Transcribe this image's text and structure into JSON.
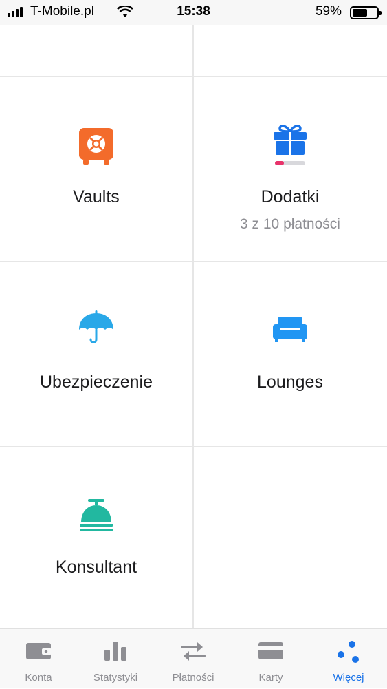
{
  "status_bar": {
    "carrier": "T-Mobile.pl",
    "time": "15:38",
    "battery": "59%"
  },
  "tiles": {
    "vaults": {
      "label": "Vaults",
      "icon": "safe-icon",
      "color": "#f36b2b"
    },
    "dodatki": {
      "label": "Dodatki",
      "sub": "3 z 10 płatności",
      "icon": "gift-icon",
      "color": "#1a73e8",
      "progress": 0.3
    },
    "ubezpieczenie": {
      "label": "Ubezpieczenie",
      "icon": "umbrella-icon",
      "color": "#29a8e8"
    },
    "lounges": {
      "label": "Lounges",
      "icon": "sofa-icon",
      "color": "#2196f3"
    },
    "konsultant": {
      "label": "Konsultant",
      "icon": "concierge-bell-icon",
      "color": "#22b8a0"
    }
  },
  "tabbar": {
    "items": [
      {
        "label": "Konta",
        "icon": "wallet-icon"
      },
      {
        "label": "Statystyki",
        "icon": "bar-chart-icon"
      },
      {
        "label": "Płatności",
        "icon": "transfer-arrows-icon"
      },
      {
        "label": "Karty",
        "icon": "card-icon"
      },
      {
        "label": "Więcej",
        "icon": "more-dots-icon",
        "active": true
      }
    ],
    "active_color": "#1a73e8",
    "inactive_color": "#8e8e93"
  }
}
